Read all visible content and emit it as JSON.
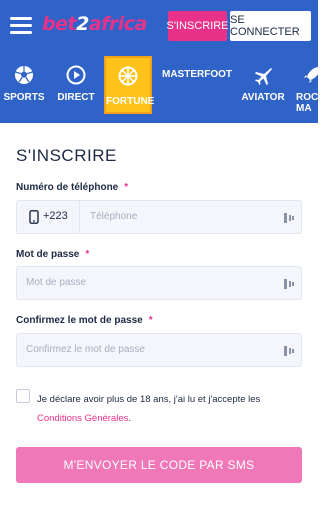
{
  "header": {
    "logo_left": "bet",
    "logo_mid": "2",
    "logo_right": "africa",
    "signup_label": "S'INSCRIRE",
    "login_label": "SE CONNECTER"
  },
  "nav": {
    "items": [
      {
        "label": "SPORTS",
        "icon": "soccer-ball-icon"
      },
      {
        "label": "DIRECT",
        "icon": "play-icon"
      },
      {
        "label": "FORTUNE",
        "icon": "wheel-icon"
      },
      {
        "label": "MASTERFOOT",
        "icon": ""
      },
      {
        "label": "AVIATOR",
        "icon": "plane-icon"
      },
      {
        "label": "ROC",
        "label2": "MA",
        "icon": "rocket-icon"
      }
    ]
  },
  "form": {
    "title": "S'INSCRIRE",
    "phone_label": "Numéro de téléphone",
    "phone_code": "+223",
    "phone_placeholder": "Téléphone",
    "password_label": "Mot de passe",
    "password_placeholder": "Mot de passe",
    "confirm_label": "Confirmez le mot de passe",
    "confirm_placeholder": "Confirmez le mot de passe",
    "required_mark": "*",
    "terms_text": "Je déclare avoir plus de 18 ans, j'ai lu et j'accepte les",
    "terms_link": "Conditions Générales",
    "terms_end": ".",
    "submit_label": "M'ENVOYER LE CODE PAR SMS"
  },
  "colors": {
    "brand_blue": "#2f63c8",
    "accent_pink": "#e8328a",
    "fortune_yellow": "#ffc21a"
  }
}
